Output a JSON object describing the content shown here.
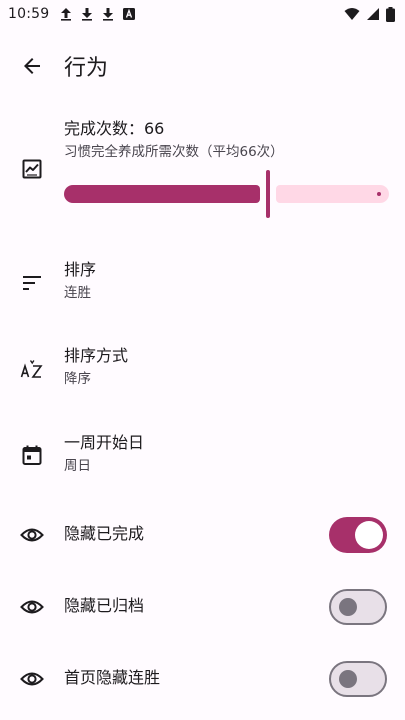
{
  "status_bar": {
    "time": "10:59",
    "notification_icons": [
      "upload-arrow-icon",
      "download-arrow-icon",
      "download-arrow-icon",
      "translate-icon"
    ],
    "system_icons": [
      "wifi-icon",
      "signal-icon",
      "battery-icon"
    ]
  },
  "app_bar": {
    "title": "行为",
    "back_icon": "arrow-back-icon"
  },
  "habit_goal": {
    "title": "完成次数：66",
    "subtitle": "习惯完全养成所需次数（平均66次）",
    "icon": "chart-icon",
    "slider_fraction": 0.62
  },
  "settings": [
    {
      "title": "排序",
      "value": "连胜",
      "icon": "sort-icon"
    },
    {
      "title": "排序方式",
      "value": "降序",
      "icon": "sort-az-icon"
    },
    {
      "title": "一周开始日",
      "value": "周日",
      "icon": "calendar-icon"
    }
  ],
  "toggles": [
    {
      "label": "隐藏已完成",
      "icon": "eye-icon",
      "checked": true
    },
    {
      "label": "隐藏已归档",
      "icon": "eye-icon",
      "checked": false
    },
    {
      "label": "首页隐藏连胜",
      "icon": "eye-icon",
      "checked": false
    }
  ],
  "colors": {
    "accent": "#a7306a",
    "accent_light": "#ffd8e6",
    "background": "#fffbff",
    "switch_off_track": "#e8e0e8",
    "switch_off_outline": "#7a757f"
  }
}
